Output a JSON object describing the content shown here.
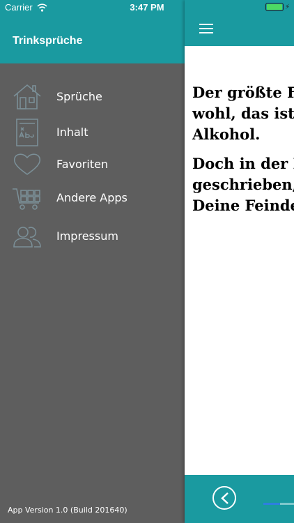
{
  "status_bar": {
    "carrier": "Carrier",
    "time": "3:47 PM",
    "battery_level": 1.0
  },
  "drawer": {
    "title": "Trinksprüche",
    "items": [
      {
        "label": "Sprüche",
        "icon": "house-icon"
      },
      {
        "label": "Inhalt",
        "icon": "abc-board-icon"
      },
      {
        "label": "Favoriten",
        "icon": "heart-icon"
      },
      {
        "label": "Andere Apps",
        "icon": "shopping-cart-icon"
      },
      {
        "label": "Impressum",
        "icon": "people-icon"
      }
    ],
    "app_version": "App Version 1.0 (Build 201640)"
  },
  "main": {
    "paragraphs": [
      [
        "Der größte F",
        "wohl, das ist",
        "Alkohol."
      ],
      [
        "Doch in der I",
        "geschrieben,",
        "Deine Feinde"
      ]
    ],
    "progress": 0.4
  },
  "colors": {
    "accent": "#1a9aa0",
    "drawer_background": "#5e5e5e",
    "content_background": "#ffffff",
    "battery_fill": "#4cd964",
    "progress_fill": "#2e7fe0"
  }
}
